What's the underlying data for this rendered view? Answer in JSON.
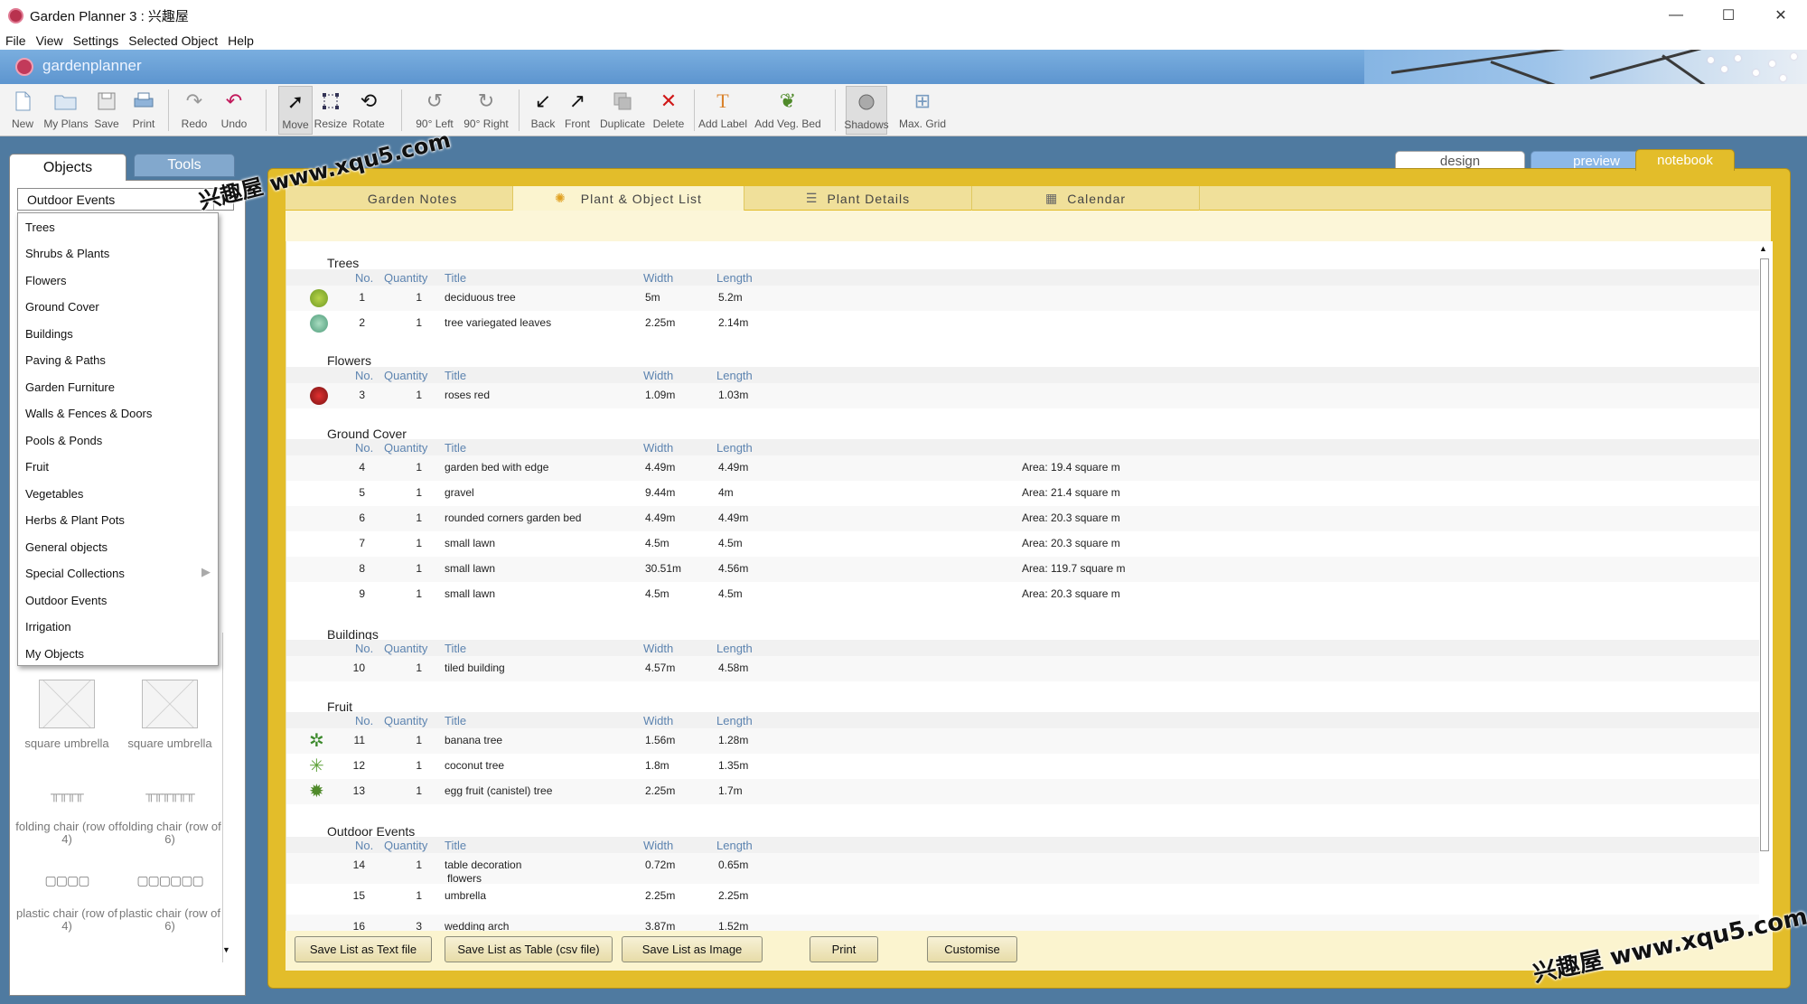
{
  "window": {
    "title": "Garden Planner 3 : 兴趣屋",
    "controls": [
      "—",
      "☐",
      "✕"
    ]
  },
  "menu": [
    "File",
    "View",
    "Settings",
    "Selected Object",
    "Help"
  ],
  "banner": {
    "brand": "gardenplanner"
  },
  "toolbar": {
    "new": "New",
    "my_plans": "My Plans",
    "save": "Save",
    "print": "Print",
    "redo": "Redo",
    "undo": "Undo",
    "move": "Move",
    "resize": "Resize",
    "rotate": "Rotate",
    "rot_left": "90° Left",
    "rot_right": "90° Right",
    "back": "Back",
    "front": "Front",
    "duplicate": "Duplicate",
    "delete": "Delete",
    "add_label": "Add Label",
    "add_veg_bed": "Add Veg. Bed",
    "shadows": "Shadows",
    "max_grid": "Max. Grid"
  },
  "left_panel": {
    "tab_objects": "Objects",
    "tab_tools": "Tools",
    "selected_category": "Outdoor Events",
    "categories": [
      "Trees",
      "Shrubs & Plants",
      "Flowers",
      "Ground Cover",
      "Buildings",
      "Paving & Paths",
      "Garden Furniture",
      "Walls & Fences & Doors",
      "Pools & Ponds",
      "Fruit",
      "Vegetables",
      "Herbs & Plant Pots",
      "General objects",
      "Special Collections",
      "Outdoor Events",
      "Irrigation",
      "My Objects"
    ],
    "submenu_arrow": "▶",
    "tiles": [
      {
        "label": "square umbrella"
      },
      {
        "label": "square umbrella"
      },
      {
        "label": "folding chair (row of 4)"
      },
      {
        "label": "folding chair (row of 6)"
      },
      {
        "label": "plastic chair (row of 4)"
      },
      {
        "label": "plastic chair (row of 6)"
      }
    ]
  },
  "view_tabs": {
    "design": "design",
    "preview": "preview",
    "notebook": "notebook"
  },
  "notebook": {
    "tabs": [
      "Garden Notes",
      "Plant & Object List",
      "Plant Details",
      "Calendar"
    ],
    "headers": {
      "no": "No.",
      "quantity": "Quantity",
      "title": "Title",
      "width": "Width",
      "length": "Length"
    },
    "sections": [
      {
        "title": "Trees",
        "rows": [
          {
            "no": "1",
            "qty": "1",
            "title": "deciduous tree",
            "width": "5m",
            "length": "5.2m",
            "extra": ""
          },
          {
            "no": "2",
            "qty": "1",
            "title": "tree variegated leaves",
            "width": "2.25m",
            "length": "2.14m",
            "extra": ""
          }
        ]
      },
      {
        "title": "Flowers",
        "rows": [
          {
            "no": "3",
            "qty": "1",
            "title": "roses red",
            "width": "1.09m",
            "length": "1.03m",
            "extra": ""
          }
        ]
      },
      {
        "title": "Ground Cover",
        "rows": [
          {
            "no": "4",
            "qty": "1",
            "title": "garden bed with edge",
            "width": "4.49m",
            "length": "4.49m",
            "extra": "Area: 19.4 square m"
          },
          {
            "no": "5",
            "qty": "1",
            "title": "gravel",
            "width": "9.44m",
            "length": "4m",
            "extra": "Area: 21.4 square m"
          },
          {
            "no": "6",
            "qty": "1",
            "title": "rounded corners garden bed",
            "width": "4.49m",
            "length": "4.49m",
            "extra": "Area: 20.3 square m"
          },
          {
            "no": "7",
            "qty": "1",
            "title": "small lawn",
            "width": "4.5m",
            "length": "4.5m",
            "extra": "Area: 20.3 square m"
          },
          {
            "no": "8",
            "qty": "1",
            "title": "small lawn",
            "width": "30.51m",
            "length": "4.56m",
            "extra": "Area: 119.7 square m"
          },
          {
            "no": "9",
            "qty": "1",
            "title": "small lawn",
            "width": "4.5m",
            "length": "4.5m",
            "extra": "Area: 20.3 square m"
          }
        ]
      },
      {
        "title": "Buildings",
        "rows": [
          {
            "no": "10",
            "qty": "1",
            "title": "tiled building",
            "width": "4.57m",
            "length": "4.58m",
            "extra": ""
          }
        ]
      },
      {
        "title": "Fruit",
        "rows": [
          {
            "no": "11",
            "qty": "1",
            "title": "banana tree",
            "width": "1.56m",
            "length": "1.28m",
            "extra": ""
          },
          {
            "no": "12",
            "qty": "1",
            "title": "coconut  tree",
            "width": "1.8m",
            "length": "1.35m",
            "extra": ""
          },
          {
            "no": "13",
            "qty": "1",
            "title": "egg fruit (canistel) tree",
            "width": "2.25m",
            "length": "1.7m",
            "extra": ""
          }
        ]
      },
      {
        "title": "Outdoor Events",
        "rows": [
          {
            "no": "14",
            "qty": "1",
            "title": "table decoration",
            "title2": "flowers",
            "width": "0.72m",
            "length": "0.65m",
            "extra": ""
          },
          {
            "no": "15",
            "qty": "1",
            "title": "umbrella",
            "width": "2.25m",
            "length": "2.25m",
            "extra": ""
          },
          {
            "no": "16",
            "qty": "3",
            "title": "wedding arch",
            "width": "3.87m",
            "length": "1.52m",
            "extra": ""
          }
        ]
      }
    ],
    "buttons": {
      "save_text": "Save List as Text file",
      "save_csv": "Save List as Table (csv file)",
      "save_image": "Save List as Image",
      "print": "Print",
      "customise": "Customise"
    }
  },
  "watermark": {
    "text": "兴趣屋 www.xqu5.com"
  },
  "colors": {
    "accent": "#e3bd2a",
    "header_text": "#5d84b0",
    "banner": "#6da2d8"
  }
}
